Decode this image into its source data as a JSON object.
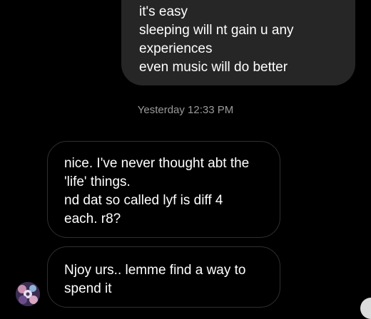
{
  "sent_message": {
    "lines": [
      "it's easy",
      "sleeping will nt gain u any",
      "experiences",
      "even music will do better"
    ]
  },
  "timestamp": "Yesterday 12:33 PM",
  "received_messages": [
    {
      "lines": [
        "nice. I've never thought abt the",
        "'life' things.",
        "nd dat so called lyf is diff 4",
        "each. r8?"
      ]
    },
    {
      "lines": [
        "Njoy urs.. lemme find a way to",
        "spend it"
      ]
    }
  ],
  "colors": {
    "background": "#000000",
    "sent_bubble": "#262626",
    "received_border": "#2f2f2f",
    "timestamp_text": "#9a9a9a"
  }
}
